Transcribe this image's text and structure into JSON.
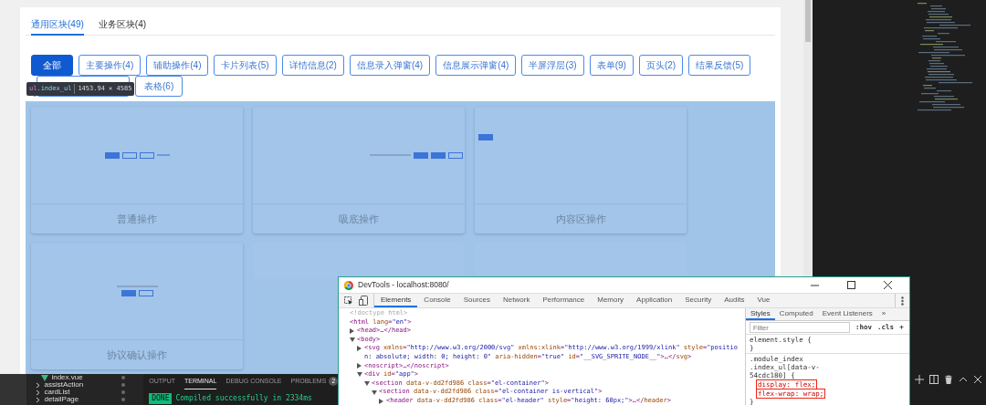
{
  "page": {
    "tabs": [
      {
        "label": "通用区块(49)",
        "selected": true
      },
      {
        "label": "业务区块(4)",
        "selected": false
      }
    ],
    "filters": [
      {
        "label": "全部",
        "selected": true
      },
      {
        "label": "主要操作(4)",
        "selected": false
      },
      {
        "label": "辅助操作(4)",
        "selected": false
      },
      {
        "label": "卡片列表(5)",
        "selected": false
      },
      {
        "label": "详情信息(2)",
        "selected": false
      },
      {
        "label": "信息录入弹窗(4)",
        "selected": false
      },
      {
        "label": "信息展示弹窗(4)",
        "selected": false
      },
      {
        "label": "半屏浮层(3)",
        "selected": false
      },
      {
        "label": "表单(9)",
        "selected": false
      },
      {
        "label": "页头(2)",
        "selected": false
      },
      {
        "label": "结果反馈(5)",
        "selected": false
      },
      {
        "kind": "covered",
        "selected": false
      },
      {
        "label": "表格(6)",
        "selected": false
      }
    ],
    "cards": [
      {
        "title": "普通操作",
        "kind": "buttons-link"
      },
      {
        "title": "吸底操作",
        "kind": "text-buttons"
      },
      {
        "title": "内容区操作",
        "kind": "edge-button"
      },
      {
        "title": "协议确认操作",
        "kind": "text-over-buttons"
      },
      {
        "kind": "empty"
      },
      {
        "kind": "empty"
      }
    ]
  },
  "tooltip": {
    "selector": "ul",
    "class_name": ".index_ul",
    "size": "1453.94 × 4585"
  },
  "devtools": {
    "title": "DevTools - localhost:8080/",
    "tabs": [
      {
        "label": "Elements",
        "selected": true
      },
      {
        "label": "Console",
        "selected": false
      },
      {
        "label": "Sources",
        "selected": false
      },
      {
        "label": "Network",
        "selected": false
      },
      {
        "label": "Performance",
        "selected": false
      },
      {
        "label": "Memory",
        "selected": false
      },
      {
        "label": "Application",
        "selected": false
      },
      {
        "label": "Security",
        "selected": false
      },
      {
        "label": "Audits",
        "selected": false
      },
      {
        "label": "Vue",
        "selected": false
      }
    ],
    "dom": [
      {
        "text": "<!doctype html>",
        "kind": "comment"
      },
      {
        "text": "<html lang=\"en\">",
        "kind": "tag",
        "children": [
          {
            "text": "<head>…</head>",
            "kind": "tag",
            "expanded": false
          },
          {
            "text": "<body>",
            "kind": "tag",
            "expanded": true,
            "children": [
              {
                "text": "<svg xmlns=\"http://www.w3.org/2000/svg\" xmlns:xlink=\"http://www.w3.org/1999/xlink\" style=\"position: absolute; width: 0; height: 0\" aria-hidden=\"true\" id=\"__SVG_SPRITE_NODE__\">…</svg>",
                "kind": "tag",
                "expanded": false
              },
              {
                "text": "<noscript>…</noscript>",
                "kind": "tag",
                "expanded": false
              },
              {
                "text": "<div id=\"app\">",
                "kind": "tag",
                "expanded": true,
                "children": [
                  {
                    "text": "<section data-v-dd2fd986 class=\"el-container\">",
                    "kind": "tag",
                    "expanded": true,
                    "children": [
                      {
                        "text": "<section data-v-dd2fd986 class=\"el-container is-vertical\">",
                        "kind": "tag",
                        "expanded": true,
                        "children": [
                          {
                            "text": "<header data-v-dd2fd986 class=\"el-header\" style=\"height: 60px;\">…</header>",
                            "kind": "tag",
                            "expanded": false
                          }
                        ]
                      }
                    ]
                  }
                ]
              }
            ]
          }
        ]
      }
    ],
    "style_tabs": [
      {
        "label": "Styles",
        "selected": true
      },
      {
        "label": "Computed",
        "selected": false
      },
      {
        "label": "Event Listeners",
        "selected": false
      },
      {
        "label": "»",
        "selected": false
      }
    ],
    "filter_placeholder": "Filter",
    "style_tools": [
      ":hov",
      ".cls",
      "+"
    ],
    "rules": [
      {
        "lines": [
          "element.style {",
          "}"
        ]
      },
      {
        "lines": [
          ".module_index",
          ".index_ul[data-v-",
          "54cdc180] {"
        ],
        "declarations": [
          {
            "text": "display: flex;",
            "marked": true
          },
          {
            "text": "flex-wrap: wrap;",
            "marked": true
          }
        ],
        "end": "}"
      }
    ]
  },
  "editor": {
    "explorer": [
      {
        "label": "index.vue",
        "kind": "file"
      },
      {
        "label": "assistAction",
        "kind": "folder"
      },
      {
        "label": "cardList",
        "kind": "folder"
      },
      {
        "label": "detailPage",
        "kind": "folder"
      }
    ],
    "panel_tabs": [
      {
        "label": "OUTPUT",
        "selected": false
      },
      {
        "label": "TERMINAL",
        "selected": true
      },
      {
        "label": "DEBUG CONSOLE",
        "selected": false
      },
      {
        "label": "PROBLEMS",
        "selected": false,
        "badge": "2"
      }
    ],
    "terminal": {
      "badge": "DONE",
      "message": "Compiled successfully in 2334ms"
    }
  }
}
